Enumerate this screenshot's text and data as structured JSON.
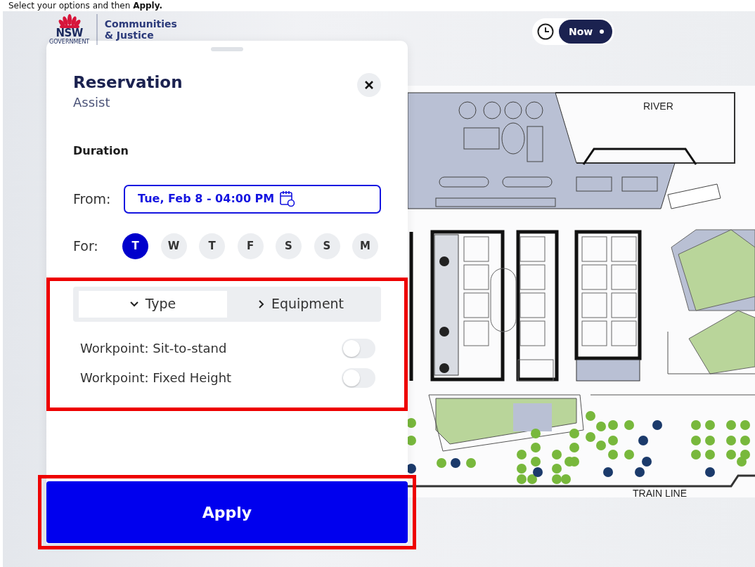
{
  "caption": "Select your options and then **Apply.**",
  "logo": {
    "mark": "NSW",
    "sub": "GOVERNMENT",
    "org_line_1": "Communities",
    "org_line_2": "& Justice"
  },
  "time_toggle": {
    "label": "Now",
    "on": true
  },
  "panel": {
    "title": "Reservation",
    "subtitle": "Assist",
    "duration_label": "Duration",
    "from_label": "From:",
    "from_value": "Tue, Feb 8 - 04:00 PM",
    "for_label": "For:",
    "days": [
      {
        "label": "T",
        "selected": true
      },
      {
        "label": "W",
        "selected": false
      },
      {
        "label": "T",
        "selected": false
      },
      {
        "label": "F",
        "selected": false
      },
      {
        "label": "S",
        "selected": false
      },
      {
        "label": "S",
        "selected": false
      },
      {
        "label": "M",
        "selected": false
      }
    ],
    "filters": {
      "highlighted": true,
      "tabs": [
        {
          "label": "Type",
          "selected": true
        },
        {
          "label": "Equipment",
          "selected": false
        }
      ],
      "options": [
        {
          "label": "Workpoint: Sit-to-stand",
          "on": false
        },
        {
          "label": "Workpoint: Fixed Height",
          "on": false
        }
      ]
    },
    "apply": {
      "label": "Apply",
      "highlighted": true
    }
  },
  "floor_plan": {
    "labels": [
      "RIVER",
      "TRAIN LINE"
    ]
  }
}
